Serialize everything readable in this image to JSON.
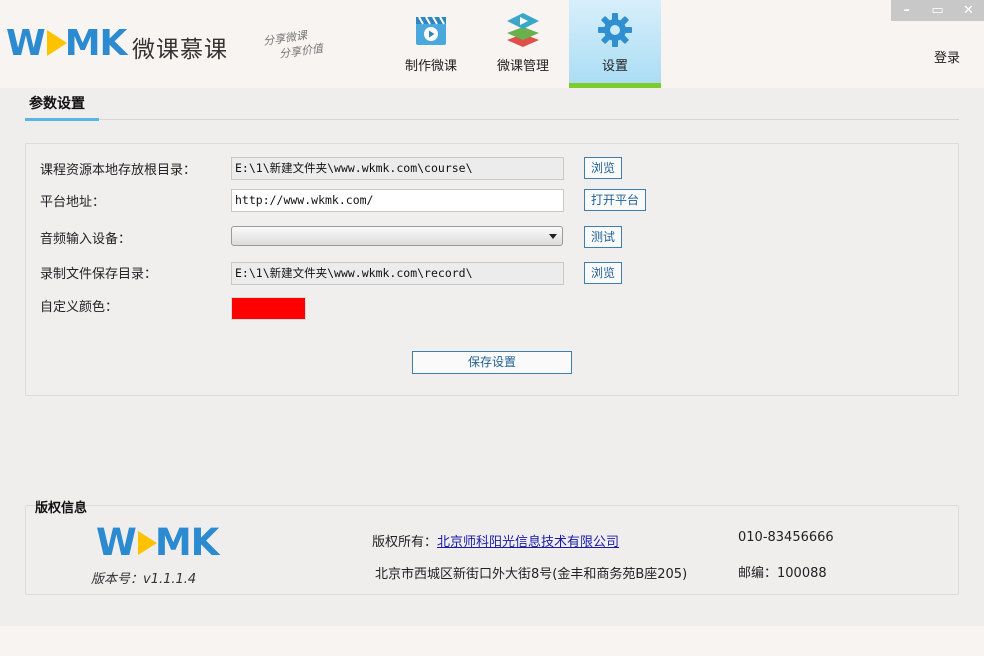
{
  "header": {
    "logo_wordmark_a": "W",
    "logo_wordmark_b": "MK",
    "logo_name": "微课慕课",
    "slogan_line1": "分享微课",
    "slogan_line2": "分享价值",
    "nav": [
      {
        "label": "制作微课",
        "icon": "video-camera-icon",
        "active": false
      },
      {
        "label": "微课管理",
        "icon": "layers-icon",
        "active": true
      },
      {
        "label": "设置",
        "icon": "gear-icon",
        "active": true
      }
    ],
    "login_label": "登录",
    "window_controls": {
      "minimize": "–",
      "maximize": "▭",
      "close": "✕"
    }
  },
  "settings": {
    "section_title": "参数设置",
    "course_dir_label": "课程资源本地存放根目录：",
    "course_dir_value": "E:\\1\\新建文件夹\\www.wkmk.com\\course\\",
    "course_dir_button": "浏览",
    "platform_label": "平台地址：",
    "platform_value": "http://www.wkmk.com/",
    "platform_button": "打开平台",
    "audio_label": "音频输入设备：",
    "audio_value": "",
    "audio_button": "测试",
    "record_dir_label": "录制文件保存目录：",
    "record_dir_value": "E:\\1\\新建文件夹\\www.wkmk.com\\record\\",
    "record_dir_button": "浏览",
    "color_label": "自定义颜色：",
    "custom_color": "#ff0000",
    "save_button": "保存设置"
  },
  "copyright": {
    "title": "版权信息",
    "logo_a": "W",
    "logo_b": "MK",
    "version_label": "版本号：",
    "version_value": "v1.1.1.4",
    "owner_label": "版权所有：",
    "owner_company": "北京师科阳光信息技术有限公司",
    "phone": "010-83456666",
    "address": "北京市西城区新街口外大街8号(金丰和商务苑B座205)",
    "postcode": "邮编：100088"
  },
  "colors": {
    "accent": "#2c8ad0",
    "active_tab": "#a9dcf4",
    "active_tab_bar": "#7ccc2c",
    "button_border": "#3d7fb0"
  }
}
